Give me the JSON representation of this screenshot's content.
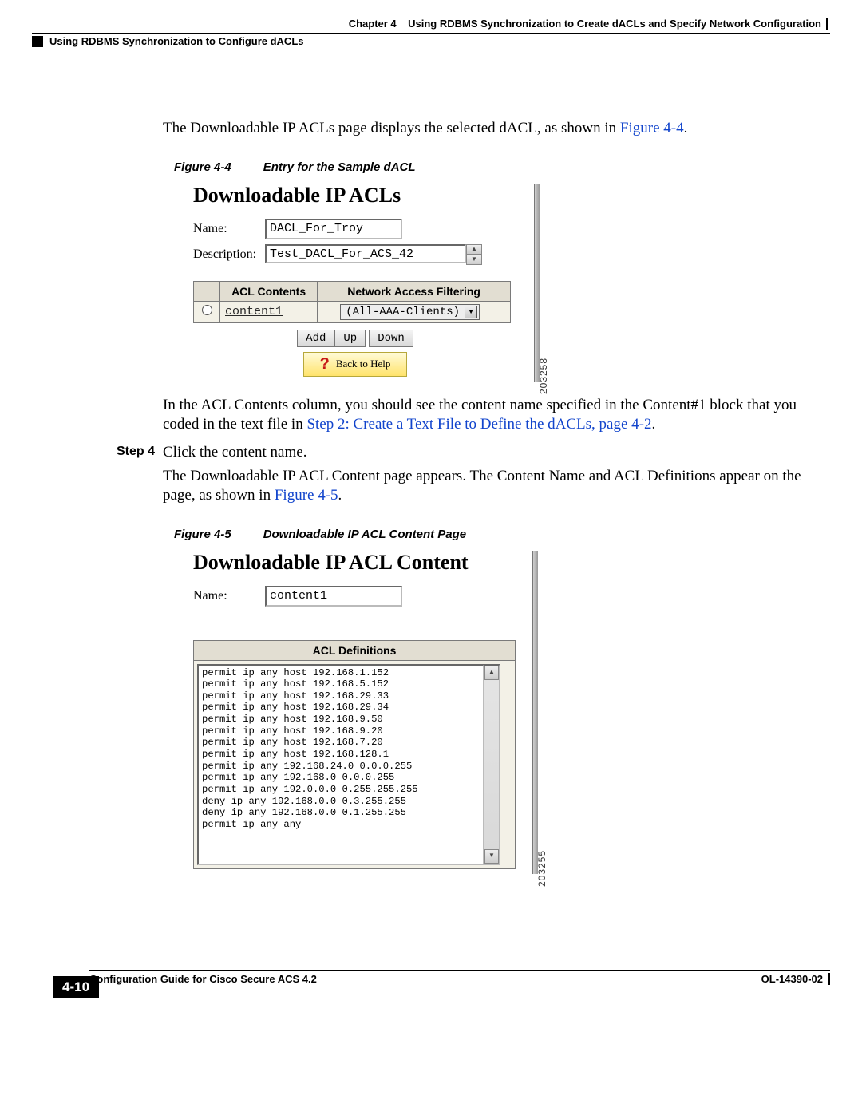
{
  "header": {
    "chapter_label": "Chapter 4",
    "chapter_title": "Using RDBMS Synchronization to Create dACLs and Specify Network Configuration",
    "section_title": "Using RDBMS Synchronization to Configure dACLs"
  },
  "para1_a": "The Downloadable IP ACLs page displays the selected dACL, as shown in ",
  "para1_link": "Figure 4-4",
  "para1_b": ".",
  "figure44": {
    "caption_num": "Figure 4-4",
    "caption_title": "Entry for the Sample dACL",
    "heading": "Downloadable IP ACLs",
    "name_label": "Name:",
    "name_value": "DACL_For_Troy",
    "desc_label": "Description:",
    "desc_value": "Test_DACL_For_ACS_42",
    "col1": "ACL Contents",
    "col2": "Network Access Filtering",
    "content_link": "content1",
    "select_value": "(All-AAA-Clients)",
    "btn_add": "Add",
    "btn_up": "Up",
    "btn_down": "Down",
    "help_label": "Back to Help",
    "sidenum": "203258"
  },
  "para2_a": "In the ACL Contents column, you should see the content name specified in the Content#1 block that you coded in the text file in ",
  "para2_link": "Step 2: Create a Text File to Define the dACLs, page 4-2",
  "para2_b": ".",
  "step4_label": "Step 4",
  "step4_text": "Click the content name.",
  "para3_a": "The Downloadable IP ACL Content page appears. The Content Name and ACL Definitions appear on the page, as shown in ",
  "para3_link": "Figure 4-5",
  "para3_b": ".",
  "figure45": {
    "caption_num": "Figure 4-5",
    "caption_title": "Downloadable IP ACL Content Page",
    "heading": "Downloadable IP ACL Content",
    "name_label": "Name:",
    "name_value": "content1",
    "defs_head": "ACL Definitions",
    "defs_lines": "permit ip any host 192.168.1.152\npermit ip any host 192.168.5.152\npermit ip any host 192.168.29.33\npermit ip any host 192.168.29.34\npermit ip any host 192.168.9.50\npermit ip any host 192.168.9.20\npermit ip any host 192.168.7.20\npermit ip any host 192.168.128.1\npermit ip any 192.168.24.0 0.0.0.255\npermit ip any 192.168.0 0.0.0.255\npermit ip any 192.0.0.0 0.255.255.255\ndeny ip any 192.168.0.0 0.3.255.255\ndeny ip any 192.168.0.0 0.1.255.255\npermit ip any any",
    "sidenum": "203255"
  },
  "footer": {
    "guide": "Configuration Guide for Cisco Secure ACS 4.2",
    "doc": "OL-14390-02",
    "pagenum": "4-10"
  }
}
